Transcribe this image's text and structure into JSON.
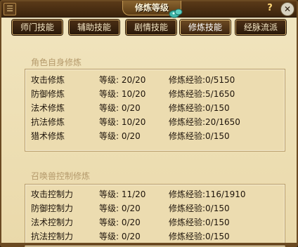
{
  "window": {
    "title": "修炼等级",
    "menu_icon": "☰",
    "help_label": "?",
    "close_label": "✕"
  },
  "tabs": [
    {
      "label": "师门技能",
      "active": false
    },
    {
      "label": "辅助技能",
      "active": false
    },
    {
      "label": "剧情技能",
      "active": false
    },
    {
      "label": "修炼技能",
      "active": true
    },
    {
      "label": "经脉流派",
      "active": false
    }
  ],
  "self_section": {
    "title": "角色自身修炼",
    "rows": [
      {
        "name": "攻击修炼",
        "level": "等级: 20/20",
        "exp": "修炼经验:0/5150"
      },
      {
        "name": "防御修炼",
        "level": "等级: 10/20",
        "exp": "修炼经验:5/1650"
      },
      {
        "name": "法术修炼",
        "level": "等级:  0/20",
        "exp": "修炼经验:0/150"
      },
      {
        "name": "抗法修炼",
        "level": "等级: 10/20",
        "exp": "修炼经验:20/1650"
      },
      {
        "name": "猎术修炼",
        "level": "等级:  0/20",
        "exp": "修炼经验:0/150"
      }
    ]
  },
  "pet_section": {
    "title": "召唤兽控制修炼",
    "rows": [
      {
        "name": "攻击控制力",
        "level": "等级: 11/20",
        "exp": "修炼经验:116/1910"
      },
      {
        "name": "防御控制力",
        "level": "等级:  0/20",
        "exp": "修炼经验:0/150"
      },
      {
        "name": "法术控制力",
        "level": "等级:  0/20",
        "exp": "修炼经验:0/150"
      },
      {
        "name": "抗法控制力",
        "level": "等级:  0/20",
        "exp": "修炼经验:0/150"
      }
    ]
  },
  "colors": {
    "frame": "#6b4a22",
    "parchment": "#ecdcb0",
    "tab_bg": "#3a2410",
    "text": "#1e140a"
  }
}
